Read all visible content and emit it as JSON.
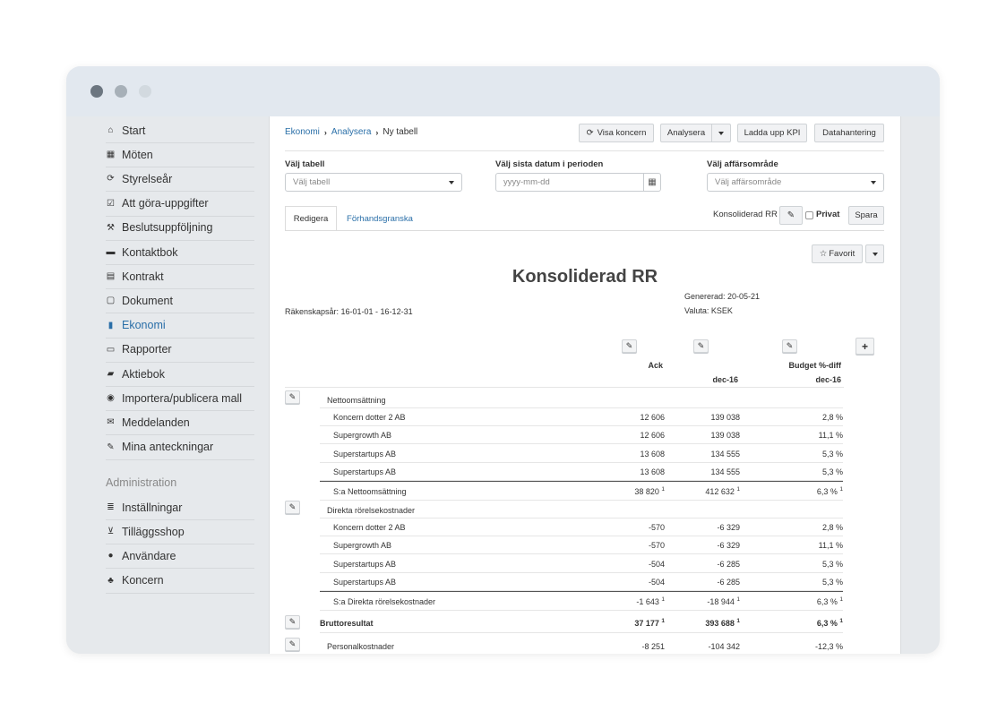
{
  "sidebar": {
    "items": [
      {
        "label": "Start",
        "icon": "home-icon",
        "glyph": "⌂"
      },
      {
        "label": "Möten",
        "icon": "calendar-icon",
        "glyph": "▦"
      },
      {
        "label": "Styrelseår",
        "icon": "refresh-icon",
        "glyph": "⟳"
      },
      {
        "label": "Att göra-uppgifter",
        "icon": "checkbox-icon",
        "glyph": "☑"
      },
      {
        "label": "Beslutsuppföljning",
        "icon": "gavel-icon",
        "glyph": "⚒"
      },
      {
        "label": "Kontaktbok",
        "icon": "book-icon",
        "glyph": "▬"
      },
      {
        "label": "Kontrakt",
        "icon": "file-text-icon",
        "glyph": "▤"
      },
      {
        "label": "Dokument",
        "icon": "file-icon",
        "glyph": "▢"
      },
      {
        "label": "Ekonomi",
        "icon": "bar-chart-icon",
        "glyph": "▮"
      },
      {
        "label": "Rapporter",
        "icon": "inbox-icon",
        "glyph": "▭"
      },
      {
        "label": "Aktiebok",
        "icon": "briefcase-icon",
        "glyph": "▰"
      },
      {
        "label": "Importera/publicera mall",
        "icon": "globe-icon",
        "glyph": "◉"
      },
      {
        "label": "Meddelanden",
        "icon": "envelope-icon",
        "glyph": "✉"
      },
      {
        "label": "Mina anteckningar",
        "icon": "pencil-icon",
        "glyph": "✎"
      }
    ],
    "admin_header": "Administration",
    "admin_items": [
      {
        "label": "Inställningar",
        "icon": "settings-icon",
        "glyph": "≣"
      },
      {
        "label": "Tilläggsshop",
        "icon": "cart-icon",
        "glyph": "⊻"
      },
      {
        "label": "Användare",
        "icon": "user-icon",
        "glyph": "●"
      },
      {
        "label": "Koncern",
        "icon": "sitemap-icon",
        "glyph": "♣"
      }
    ]
  },
  "breadcrumb": {
    "items": [
      "Ekonomi",
      "Analysera",
      "Ny tabell"
    ]
  },
  "toolbar": {
    "visa_koncern": "Visa koncern",
    "analysera": "Analysera",
    "ladda_upp": "Ladda upp KPI",
    "datahantering": "Datahantering"
  },
  "filters": {
    "table_label": "Välj tabell",
    "table_placeholder": "Välj tabell",
    "date_label": "Välj sista datum i perioden",
    "date_placeholder": "yyyy-mm-dd",
    "area_label": "Välj affärsområde",
    "area_placeholder": "Välj affärsområde"
  },
  "tabs": {
    "edit": "Redigera",
    "preview": "Förhandsgranska"
  },
  "save_bar": {
    "name": "Konsoliderad RR",
    "private_label": "Privat",
    "save": "Spara"
  },
  "favorite": {
    "label": "Favorit"
  },
  "report": {
    "title": "Konsoliderad RR",
    "fiscal_year": "Räkenskapsår: 16-01-01 - 16-12-31",
    "generated": "Genererad: 20-05-21",
    "currency": "Valuta: KSEK",
    "col1_header": "Ack",
    "col2_header": "dec-16",
    "col3_header_line1": "Budget %-diff",
    "col3_header_line2": "dec-16",
    "groups": [
      {
        "name": "Nettoomsättning",
        "rows": [
          {
            "name": "Koncern dotter 2 AB",
            "c1": "12 606",
            "c2": "139 038",
            "c3": "2,8 %"
          },
          {
            "name": "Supergrowth AB",
            "c1": "12 606",
            "c2": "139 038",
            "c3": "11,1 %"
          },
          {
            "name": "Superstartups AB",
            "c1": "13 608",
            "c2": "134 555",
            "c3": "5,3 %"
          },
          {
            "name": "Superstartups AB",
            "c1": "13 608",
            "c2": "134 555",
            "c3": "5,3 %"
          }
        ],
        "sum": {
          "name": "S:a Nettoomsättning",
          "c1": "38 820",
          "c2": "412 632",
          "c3": "6,3 %",
          "footnote": "1"
        }
      },
      {
        "name": "Direkta rörelsekostnader",
        "rows": [
          {
            "name": "Koncern dotter 2 AB",
            "c1": "-570",
            "c2": "-6 329",
            "c3": "2,8 %"
          },
          {
            "name": "Supergrowth AB",
            "c1": "-570",
            "c2": "-6 329",
            "c3": "11,1 %"
          },
          {
            "name": "Superstartups AB",
            "c1": "-504",
            "c2": "-6 285",
            "c3": "5,3 %"
          },
          {
            "name": "Superstartups AB",
            "c1": "-504",
            "c2": "-6 285",
            "c3": "5,3 %"
          }
        ],
        "sum": {
          "name": "S:a Direkta rörelsekostnader",
          "c1": "-1 643",
          "c2": "-18 944",
          "c3": "6,3 %",
          "footnote": "1"
        }
      }
    ],
    "gross": {
      "name": "Bruttoresultat",
      "c1": "37 177",
      "c2": "393 688",
      "c3": "6,3 %",
      "footnote": "1"
    },
    "personal": {
      "name": "Personalkostnader",
      "c1": "-8 251",
      "c2": "-104 342",
      "c3": "-12,3 %"
    }
  }
}
